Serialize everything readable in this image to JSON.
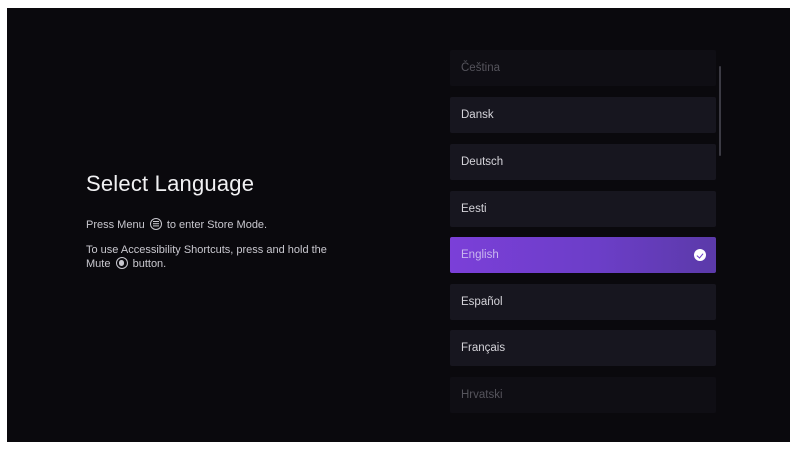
{
  "screen": {
    "title": "Select Language",
    "hint_store_prefix": "Press Menu",
    "hint_store_suffix": "to enter Store Mode.",
    "hint_access_line1": "To use Accessibility Shortcuts, press and hold the",
    "hint_access_prefix2": "Mute",
    "hint_access_suffix2": "button."
  },
  "languages": [
    {
      "label": "Čeština",
      "state": "faded"
    },
    {
      "label": "Dansk",
      "state": "normal"
    },
    {
      "label": "Deutsch",
      "state": "normal"
    },
    {
      "label": "Eesti",
      "state": "normal"
    },
    {
      "label": "English",
      "state": "selected"
    },
    {
      "label": "Español",
      "state": "normal"
    },
    {
      "label": "Français",
      "state": "normal"
    },
    {
      "label": "Hrvatski",
      "state": "faded"
    }
  ],
  "icons": {
    "menu_button": "menu-button-icon",
    "mute_button": "mute-button-icon",
    "selected_check": "checkmark-icon"
  },
  "colors": {
    "background": "#0a090d",
    "list_item": "#17161f",
    "selected_gradient_start": "#7b3fd8",
    "selected_gradient_end": "#5b3aa9",
    "text_primary": "#f1f1f3"
  }
}
